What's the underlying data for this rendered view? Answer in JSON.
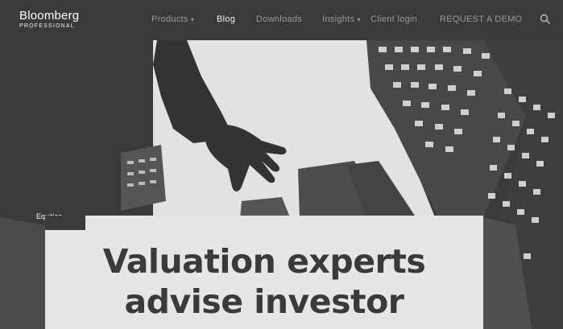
{
  "brand": {
    "name": "Bloomberg",
    "sub": "PROFESSIONAL"
  },
  "nav": {
    "items": [
      {
        "label": "Products",
        "has_menu": true
      },
      {
        "label": "Blog",
        "active": true
      },
      {
        "label": "Downloads"
      },
      {
        "label": "Insights",
        "has_menu": true
      },
      {
        "label": "Client login"
      },
      {
        "label": "REQUEST A DEMO"
      }
    ]
  },
  "article": {
    "category": "Equities",
    "headline_line1": "Valuation experts",
    "headline_line2": "advise investor"
  },
  "colors": {
    "background": "#3a3a3a",
    "card": "#e6e6e6",
    "nav_text": "#9a9a9a"
  },
  "icons": {
    "search": "search-icon"
  }
}
